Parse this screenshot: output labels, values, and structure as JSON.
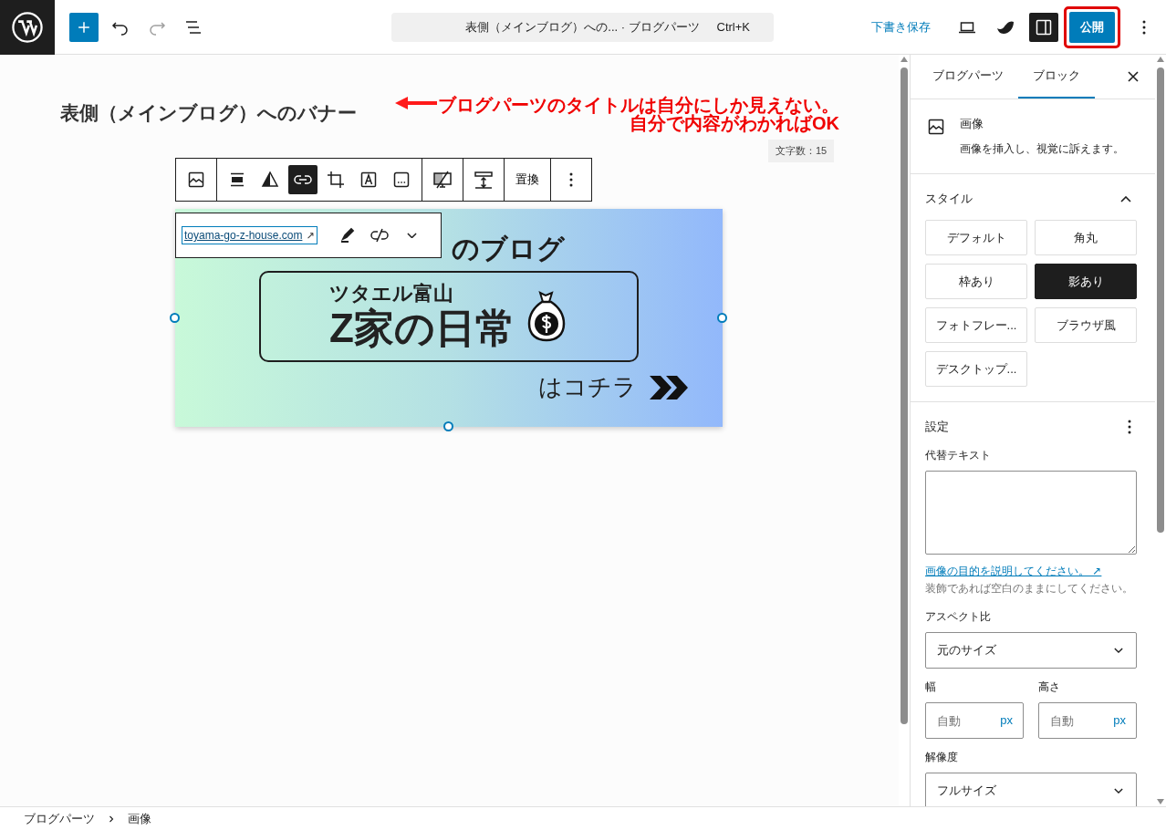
{
  "topbar": {
    "undo": {
      "disabled": false
    },
    "redo": {
      "disabled": true
    },
    "command_bar": {
      "title": "表側（メインブログ）への... · ブログパーツ",
      "shortcut": "Ctrl+K"
    },
    "save_draft": "下書き保存",
    "settings_toggle": {
      "pressed": true
    },
    "publish": "公開"
  },
  "annotation": {
    "lines": [
      "ブログパーツのタイトルは自分にしか見えない。",
      "自分で内容がわかればOK"
    ],
    "highlight_publish": true
  },
  "editor": {
    "title": "表側（メインブログ）へのバナー",
    "word_count": "文字数：15",
    "toolbar": [
      {
        "items": [
          {
            "selected": false
          }
        ]
      },
      {
        "items": [
          {
            "selected": false
          },
          {
            "selected": false
          },
          {
            "selected": true
          },
          {
            "selected": false
          },
          {
            "selected": false
          },
          {
            "selected": false
          }
        ]
      },
      {
        "items": [
          {
            "selected": false
          }
        ]
      },
      {
        "items": [
          {
            "selected": false
          }
        ]
      },
      {
        "label": "置換"
      },
      {
        "items": [
          {
            "selected": false
          }
        ]
      }
    ],
    "link": {
      "url": "toyama-go-z-house.com",
      "arrow": "↗"
    },
    "banner": {
      "heading": "のブログ",
      "box_line_1": "ツタエル富山",
      "box_line_2": "Z家の日常",
      "cta": "はコチラ"
    }
  },
  "sidebar": {
    "tabs": [
      {
        "label": "ブログパーツ",
        "selected": false
      },
      {
        "label": "ブロック",
        "selected": true
      }
    ],
    "block": {
      "title": "画像",
      "description": "画像を挿入し、視覚に訴えます。"
    },
    "styles": {
      "title": "スタイル",
      "expanded": true,
      "options": [
        {
          "label": "デフォルト",
          "selected": false
        },
        {
          "label": "角丸",
          "selected": false
        },
        {
          "label": "枠あり",
          "selected": false
        },
        {
          "label": "影あり",
          "selected": true
        },
        {
          "label": "フォトフレー...",
          "selected": false
        },
        {
          "label": "ブラウザ風",
          "selected": false
        },
        {
          "label": "デスクトップ...",
          "selected": false
        }
      ]
    },
    "settings": {
      "title": "設定",
      "alt_text_label": "代替テキスト",
      "help_link": "画像の目的を説明してください。",
      "help_arrow": "↗",
      "help_note": "装飾であれば空白のままにしてください。",
      "aspect_label": "アスペクト比",
      "aspect_value": "元のサイズ",
      "width_label": "幅",
      "width_placeholder": "自動",
      "width_unit": "px",
      "height_label": "高さ",
      "height_placeholder": "自動",
      "height_unit": "px",
      "resolution_label": "解像度",
      "resolution_value": "フルサイズ"
    }
  },
  "breadcrumb": [
    "ブログパーツ",
    "画像"
  ]
}
